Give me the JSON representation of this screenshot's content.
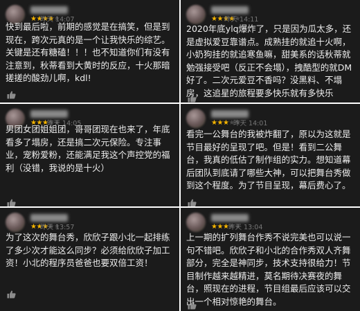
{
  "reviews": [
    {
      "username": "琴若菠菠",
      "rating": 4,
      "time": "昨天 14:07",
      "content": "快到最后啦，前期的感觉是在搞笑，但是到现在，跨次元真的是一个让我快乐的综艺。关键是还有糖磕！！！也不知道你们有没有注意到，秋蒂看到大黄时的反应，十火那暗搓搓的酸劲儿啊，kdl!"
    },
    {
      "username": "读书城的",
      "rating": 3,
      "time": "昨天 14:05",
      "content": "男团女团姐姐团，哥哥团现在也来了，年底看多了塌房，还是搞二次元保险。专注事业，宠粉爱粉，还能满足我这个声控党的福利（没错，我说的是十火）"
    },
    {
      "username": "醒醒小熊",
      "rating": 3,
      "time": "昨天 13:57",
      "content": "为了这次的舞台秀，欣欣子跟小北一起排练了多少次才能这么同步？必须给欣欣子加工资！小北的程序员爸爸也要双倍工资！"
    },
    {
      "username": "溪溪溪溪",
      "rating": 4,
      "time": "昨天 14:11",
      "content": "2020年底ylq爆炸了，只是因为瓜太多，还是虚拟爱豆靠谱点。成熟挂的就追十火啊，小奶狗挂的就追寒鱼嘛，甜美系的话秋蒂就勉强接受吧（反正不会塌），拽酷型的就DM好了。二次元爱豆不香吗？没黑料、不塌房，这追星的旅程要多快乐就有多快乐"
    },
    {
      "username": "忙着写着爱",
      "rating": 3,
      "time": "昨天 14:01",
      "content": "看完一公舞台的我被炸翻了，原以为这就是节目最好的呈现了吧。但是！看到二公舞台，我真的低估了制作组的实力。想知道幕后团队到底请了哪些大神，可以把舞台秀做到这个程度。为了节目呈现，幕后费心了。"
    },
    {
      "username": "吸音的",
      "rating": 3,
      "time": "昨天 13:04",
      "content": "上一期的扩列舞台作秀不说完美也可以说一句不错吧。欣欣子和小北的合作秀双人齐舞部分，完全是神同步，技术支持很给力！节目制作越来越精进，莫名期待决赛夜的舞台，照现在的进程，节目组最后应该可以交出一个相对惊艳的舞台。"
    }
  ],
  "icons": {
    "like": "thumbs-up-icon",
    "star": "star-icon"
  },
  "colors": {
    "card_bg": "#1b1b1b",
    "star": "#f5b400",
    "text": "#ededed",
    "time": "#777777"
  }
}
